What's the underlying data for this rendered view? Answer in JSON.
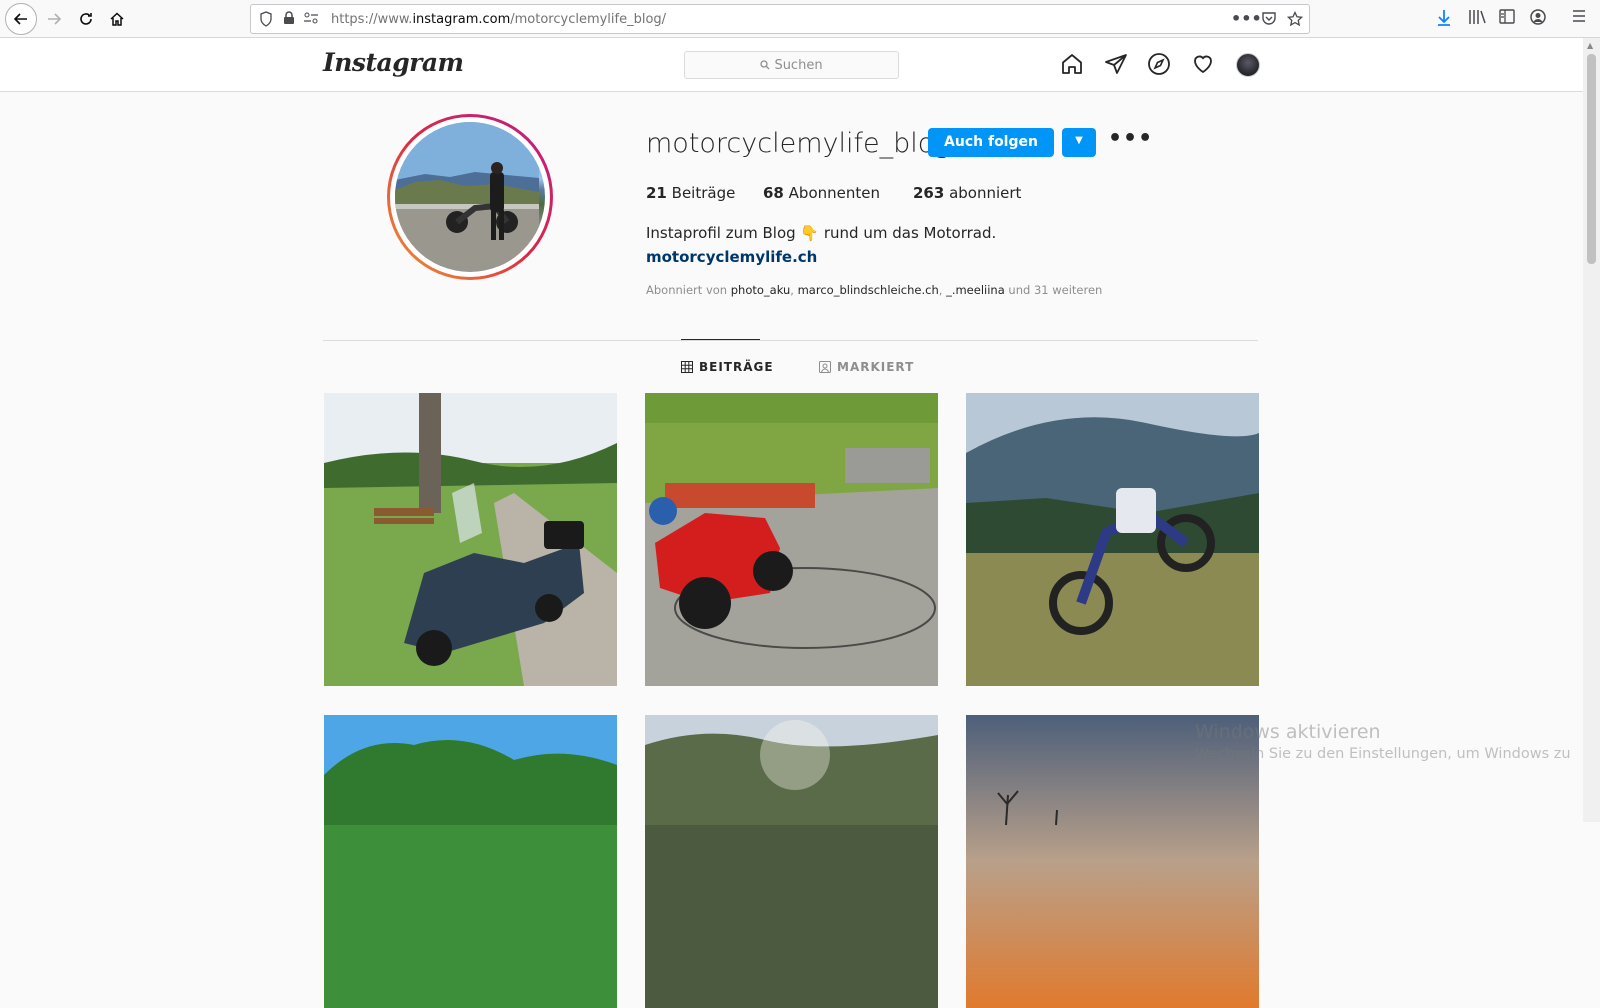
{
  "browser": {
    "url_prefix": "https://www.",
    "url_domain": "instagram.com",
    "url_path": "/motorcyclemylife_blog/"
  },
  "header": {
    "logo": "Instagram",
    "search_placeholder": "Suchen"
  },
  "profile": {
    "username": "motorcyclemylife_blog",
    "follow_label": "Auch folgen",
    "more_label": "•••",
    "posts_count": "21",
    "posts_label": "Beiträge",
    "followers_count": "68",
    "followers_label": "Abonnenten",
    "following_count": "263",
    "following_label": "abonniert",
    "bio": "Instaprofil zum Blog 👇 rund um das Motorrad.",
    "website": "motorcyclemylife.ch",
    "followed_by_prefix": "Abonniert von",
    "followed_by_names": [
      "photo_aku",
      "marco_blindschleiche.ch",
      "_.meeliina"
    ],
    "followed_by_suffix": "und 31 weiteren"
  },
  "tabs": {
    "posts": "BEITRÄGE",
    "tagged": "MARKIERT"
  },
  "posts": [
    {
      "subject": "blue scooter on country road"
    },
    {
      "subject": "red sport motorcycle on asphalt"
    },
    {
      "subject": "trial motorcycle in meadow"
    },
    {
      "subject": "green hill under blue sky"
    },
    {
      "subject": "trees with sun flare"
    },
    {
      "subject": "sunset sky"
    }
  ],
  "watermark": {
    "title": "Windows aktivieren",
    "subtitle": "Wechseln Sie zu den Einstellungen, um Windows zu"
  }
}
